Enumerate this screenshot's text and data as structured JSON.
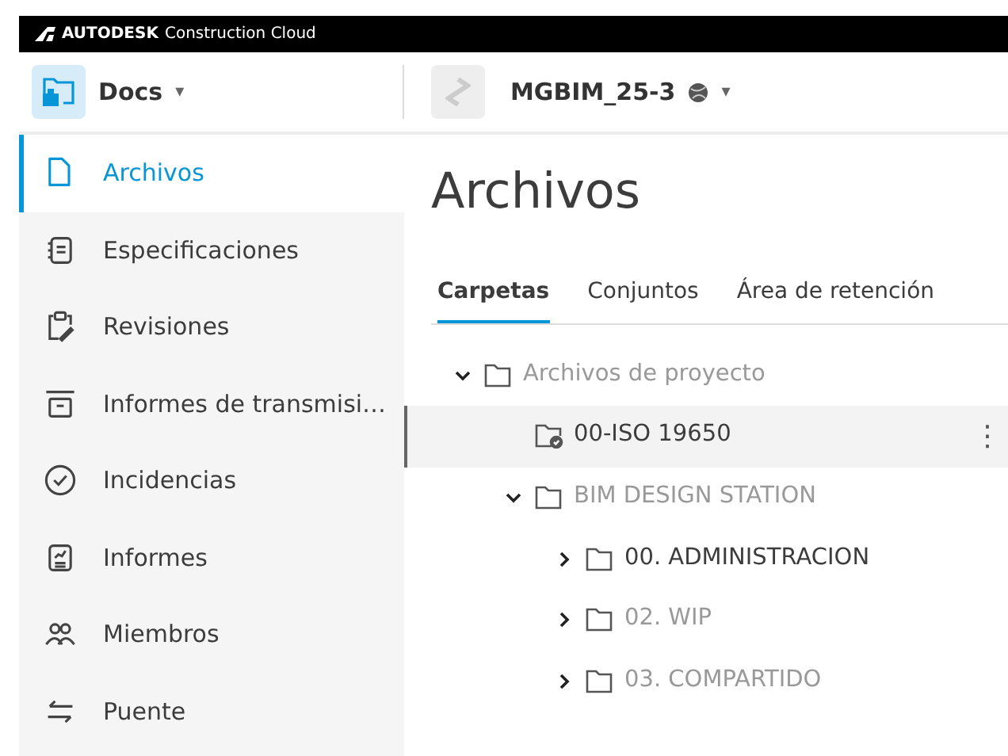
{
  "brand": {
    "name": "AUTODESK",
    "product": "Construction Cloud"
  },
  "app_switcher": {
    "label": "Docs",
    "caret": "▾"
  },
  "project": {
    "name": "MGBIM_25-3",
    "caret": "▾"
  },
  "sidebar": {
    "items": [
      {
        "label": "Archivos",
        "selected": true
      },
      {
        "label": "Especificaciones",
        "selected": false
      },
      {
        "label": "Revisiones",
        "selected": false
      },
      {
        "label": "Informes de transmisi…",
        "selected": false
      },
      {
        "label": "Incidencias",
        "selected": false
      },
      {
        "label": "Informes",
        "selected": false
      },
      {
        "label": "Miembros",
        "selected": false
      },
      {
        "label": "Puente",
        "selected": false
      }
    ]
  },
  "page_title": "Archivos",
  "tabs": [
    {
      "label": "Carpetas",
      "selected": true
    },
    {
      "label": "Conjuntos",
      "selected": false
    },
    {
      "label": "Área de retención",
      "selected": false
    }
  ],
  "tree": [
    {
      "label": "Archivos de proyecto",
      "dimmed": true,
      "expanded": true,
      "selected": false,
      "children": [
        {
          "label": "00-ISO 19650",
          "dimmed": false,
          "kind": "shared",
          "selected": true,
          "more": "⋮"
        },
        {
          "label": "BIM DESIGN STATION",
          "dimmed": true,
          "expanded": true,
          "selected": false,
          "children": [
            {
              "label": "00. ADMINISTRACION",
              "dimmed": false,
              "expanded": false,
              "selected": false
            },
            {
              "label": "02. WIP",
              "dimmed": true,
              "expanded": false,
              "selected": false
            },
            {
              "label": "03. COMPARTIDO",
              "dimmed": true,
              "expanded": false,
              "selected": false
            }
          ]
        }
      ]
    }
  ]
}
